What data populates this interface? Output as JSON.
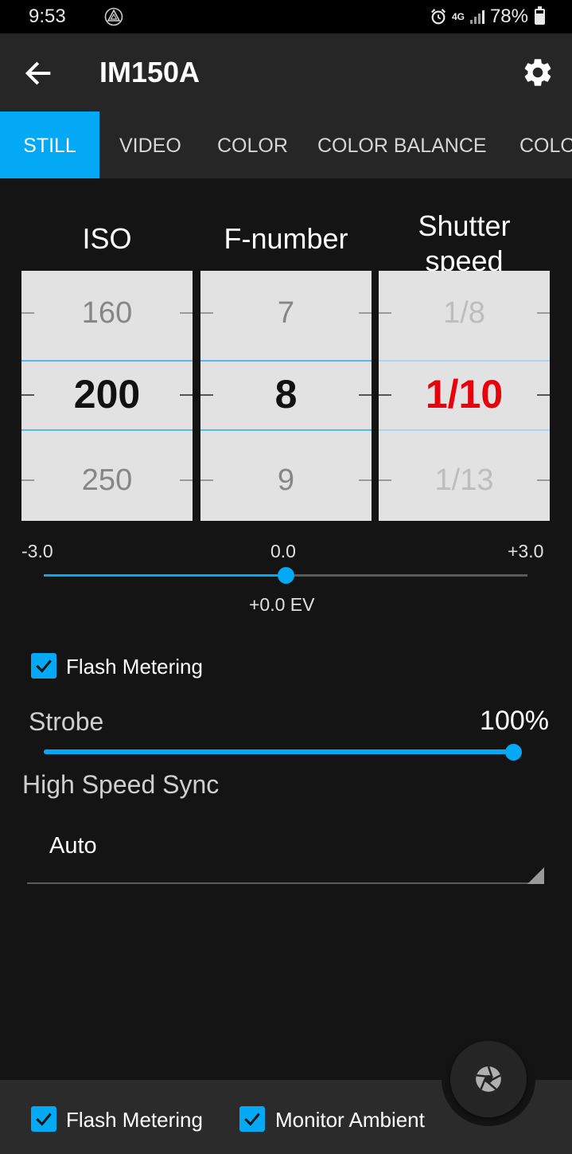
{
  "status_bar": {
    "time": "9:53",
    "network": "4G",
    "battery": "78%"
  },
  "app_bar": {
    "title": "IM150A",
    "back_icon": "arrow-left-icon",
    "settings_icon": "gear-icon"
  },
  "tabs": [
    {
      "label": "STILL",
      "active": true
    },
    {
      "label": "VIDEO",
      "active": false
    },
    {
      "label": "COLOR",
      "active": false
    },
    {
      "label": "COLOR BALANCE",
      "active": false
    },
    {
      "label": "COLO",
      "active": false
    }
  ],
  "exposure": {
    "iso": {
      "label": "ISO",
      "prev": "160",
      "current": "200",
      "next": "250"
    },
    "fnumber": {
      "label": "F-number",
      "prev": "7",
      "current": "8",
      "next": "9"
    },
    "shutter": {
      "label_line1": "Shutter",
      "label_line2": "speed",
      "prev": "1/8",
      "current": "1/10",
      "next": "1/13",
      "current_color": "#e8000b"
    }
  },
  "ev": {
    "min_label": "-3.0",
    "mid_label": "0.0",
    "max_label": "+3.0",
    "value_label": "+0.0 EV",
    "value": 0.0,
    "min": -3.0,
    "max": 3.0
  },
  "flash_metering": {
    "label": "Flash Metering",
    "checked": true
  },
  "strobe": {
    "label": "Strobe",
    "value_label": "100%",
    "value": 100
  },
  "high_speed_sync": {
    "label": "High Speed Sync",
    "selected": "Auto"
  },
  "bottom_bar": {
    "flash_metering": {
      "label": "Flash Metering",
      "checked": true
    },
    "monitor_ambient": {
      "label": "Monitor Ambient",
      "checked": true
    },
    "shutter_icon": "aperture-icon"
  },
  "colors": {
    "accent": "#03a9f4",
    "background": "#141414",
    "bar": "#262626"
  }
}
